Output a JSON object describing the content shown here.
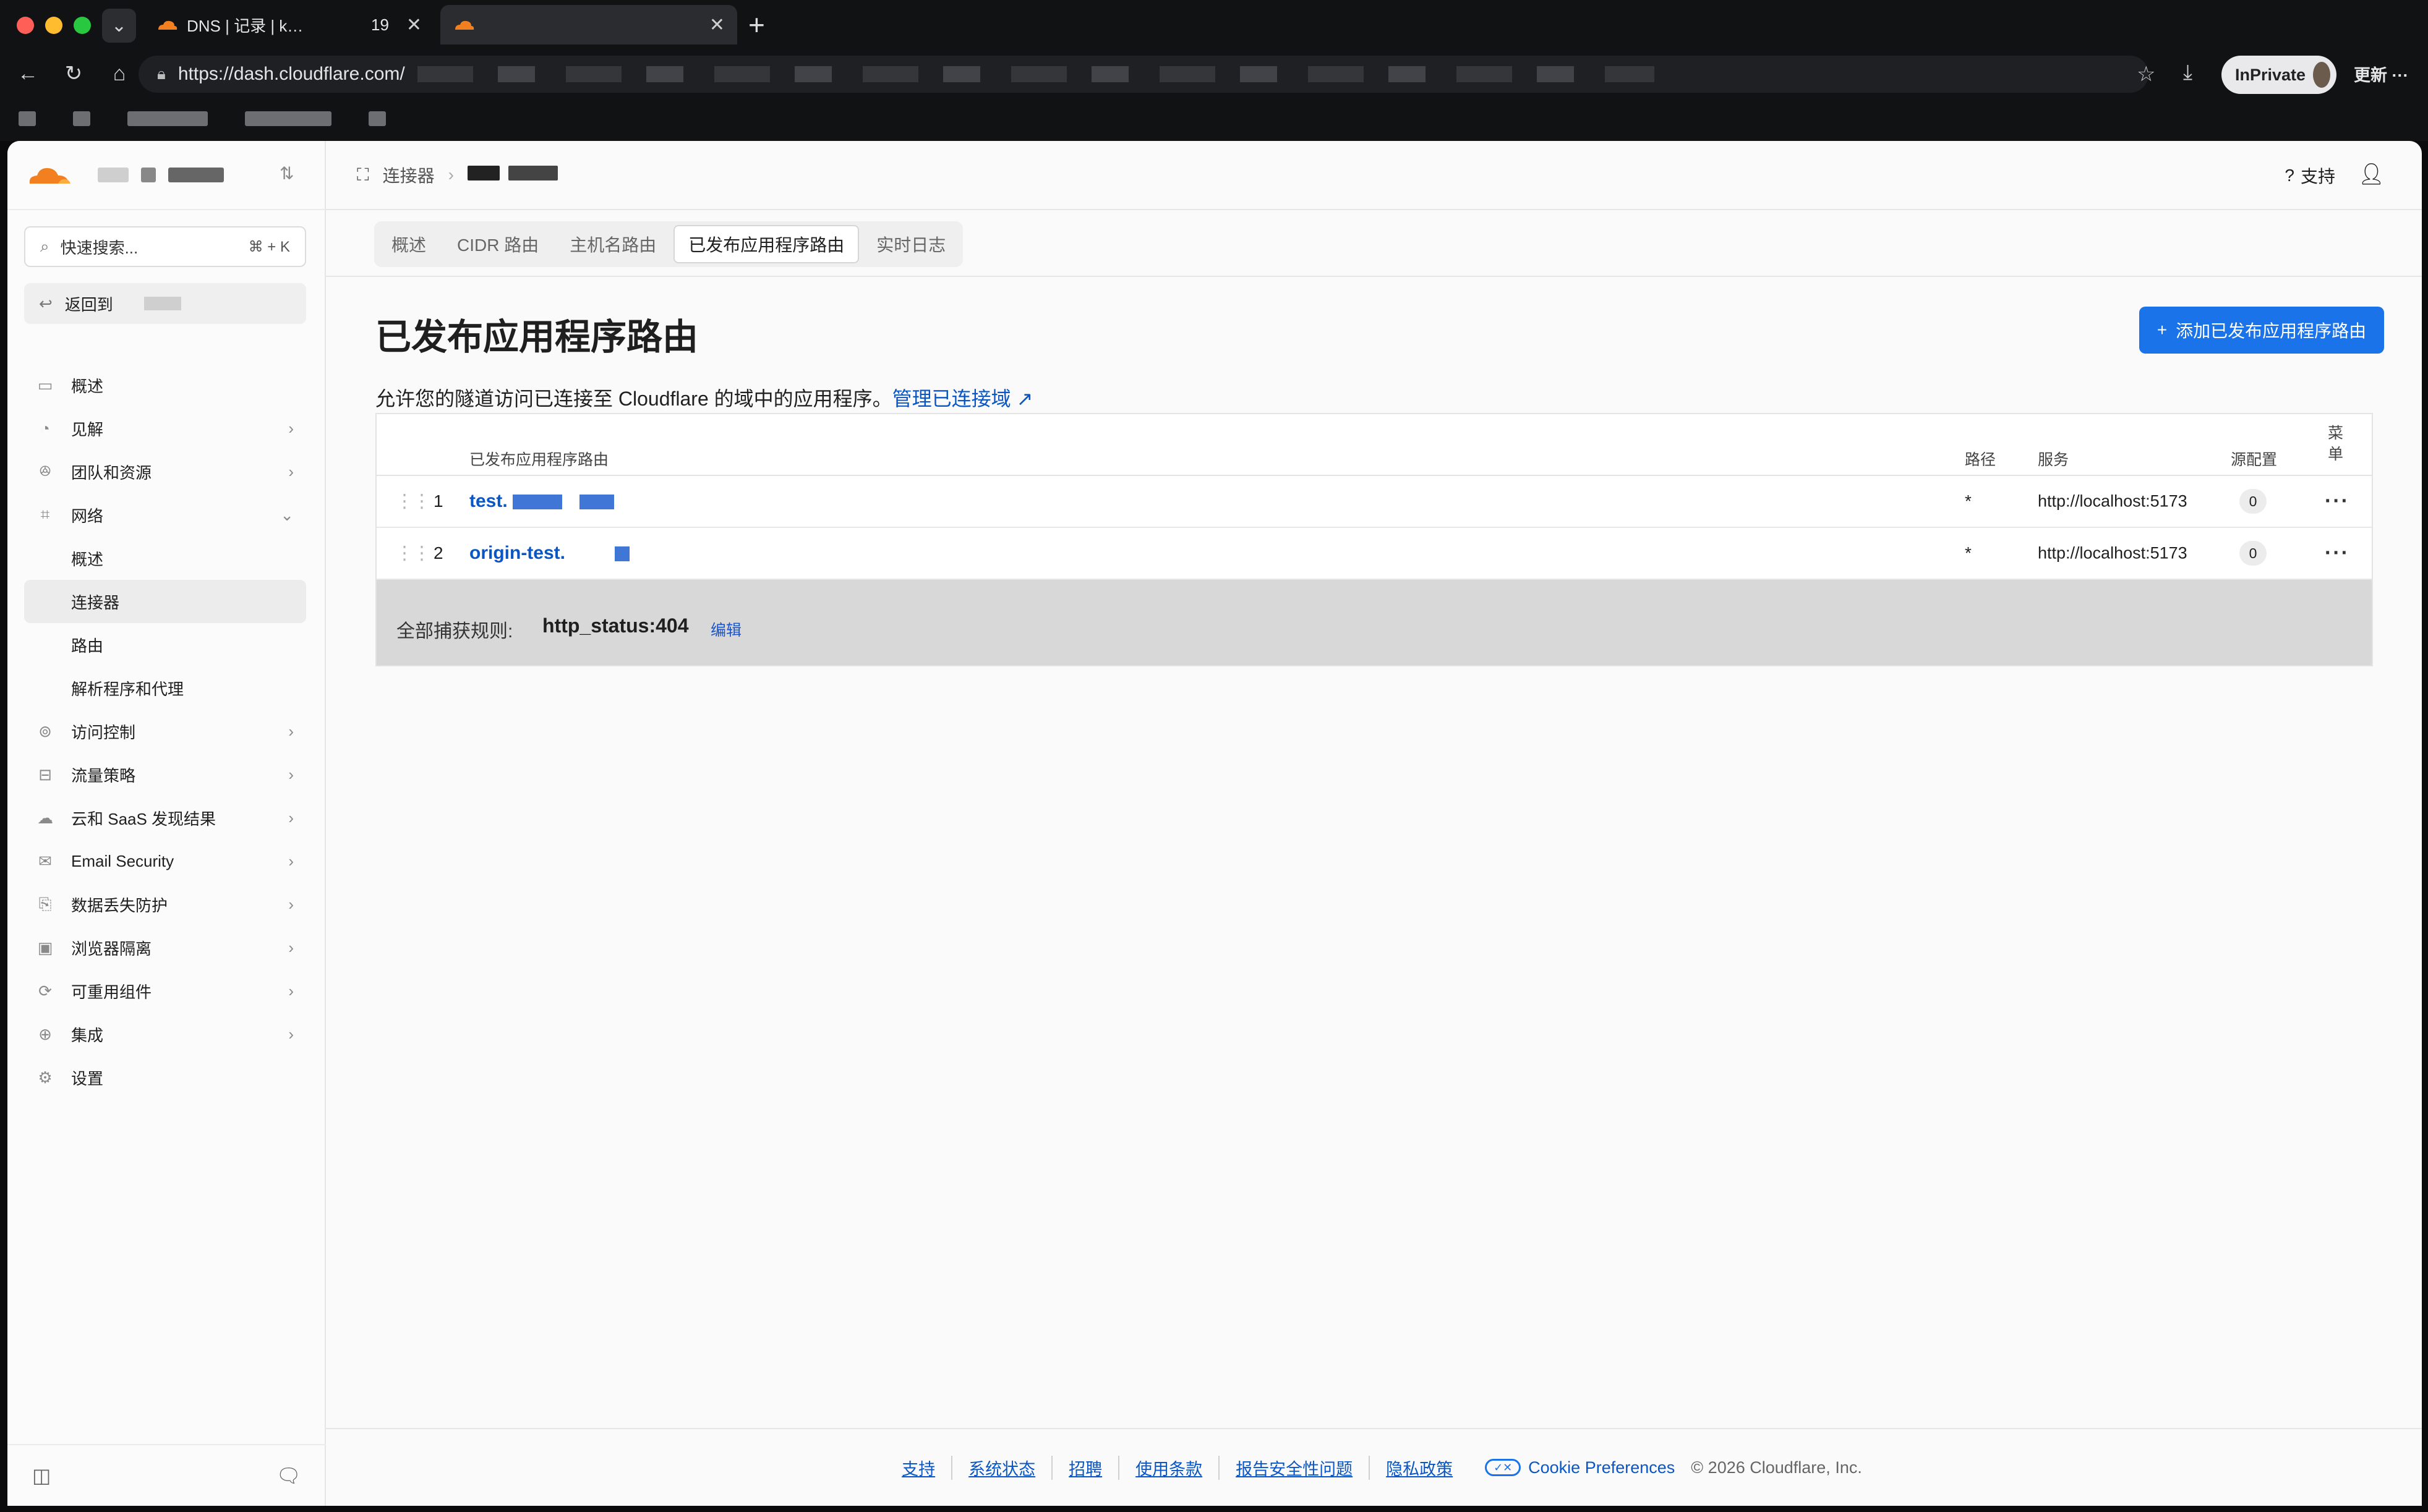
{
  "browser": {
    "tabs": [
      {
        "title": "DNS | 记录 | k…",
        "active": false
      },
      {
        "title": "19",
        "active": false
      },
      {
        "title": "",
        "active": true
      }
    ],
    "url": "https://dash.cloudflare.com/",
    "inprivate_label": "InPrivate",
    "update_label": "更新"
  },
  "sidebar": {
    "search_placeholder": "快速搜索...",
    "search_shortcut": "⌘ + K",
    "back_label": "返回到",
    "items": [
      {
        "label": "概述",
        "icon": "overview-icon",
        "chevron": false
      },
      {
        "label": "见解",
        "icon": "insights-icon",
        "chevron": true
      },
      {
        "label": "团队和资源",
        "icon": "team-icon",
        "chevron": true
      },
      {
        "label": "网络",
        "icon": "network-icon",
        "chevron": "down"
      }
    ],
    "network_sub": [
      "概述",
      "连接器",
      "路由",
      "解析程序和代理"
    ],
    "items2": [
      {
        "label": "访问控制",
        "icon": "access-icon"
      },
      {
        "label": "流量策略",
        "icon": "traffic-icon"
      },
      {
        "label": "云和 SaaS 发现结果",
        "icon": "cloud-icon"
      },
      {
        "label": "Email Security",
        "icon": "email-icon"
      },
      {
        "label": "数据丢失防护",
        "icon": "dlp-icon"
      },
      {
        "label": "浏览器隔离",
        "icon": "browser-icon"
      },
      {
        "label": "可重用组件",
        "icon": "reuse-icon"
      },
      {
        "label": "集成",
        "icon": "integration-icon"
      }
    ],
    "settings_label": "设置"
  },
  "topbar": {
    "breadcrumb_root": "连接器",
    "support_label": "支持"
  },
  "tabs": [
    "概述",
    "CIDR 路由",
    "主机名路由",
    "已发布应用程序路由",
    "实时日志"
  ],
  "active_tab": 3,
  "page": {
    "title": "已发布应用程序路由",
    "add_button": "添加已发布应用程序路由",
    "description": "允许您的隧道访问已连接至 Cloudflare 的域中的应用程序。",
    "manage_link": "管理已连接域"
  },
  "table": {
    "headers": {
      "route": "已发布应用程序路由",
      "path": "路径",
      "service": "服务",
      "origin_config": "源配置",
      "menu": "菜单"
    },
    "rows": [
      {
        "index": "1",
        "host": "test.",
        "path": "*",
        "service": "http://localhost:5173",
        "origin": "0"
      },
      {
        "index": "2",
        "host": "origin-test.",
        "path": "*",
        "service": "http://localhost:5173",
        "origin": "0"
      }
    ],
    "catchall": {
      "label": "全部捕获规则:",
      "value": "http_status:404",
      "edit": "编辑"
    }
  },
  "footer": {
    "links": [
      "支持",
      "系统状态",
      "招聘",
      "使用条款",
      "报告安全性问题",
      "隐私政策"
    ],
    "cookie": "Cookie Preferences",
    "copyright": "© 2026 Cloudflare, Inc."
  },
  "colors": {
    "accent": "#1a73e8",
    "link": "#0a56c4",
    "cloudflare_orange": "#f38020"
  }
}
